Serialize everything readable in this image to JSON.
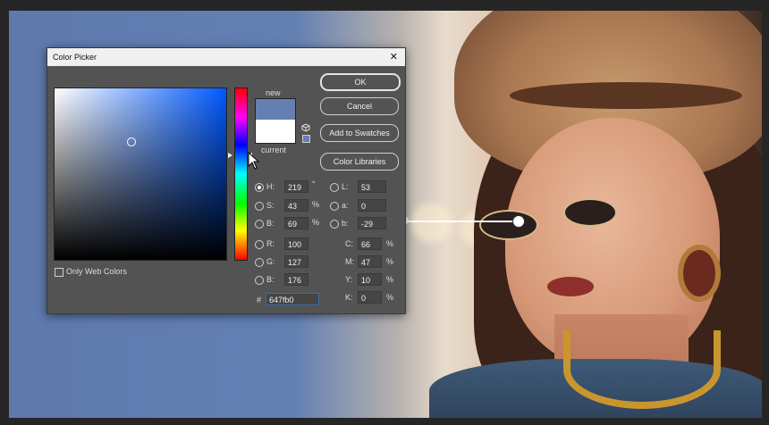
{
  "dialog": {
    "title": "Color Picker",
    "close_glyph": "✕",
    "labels": {
      "new": "new",
      "current": "current"
    },
    "colors": {
      "new": "#647fb0",
      "current": "#ffffff"
    },
    "buttons": {
      "ok": "OK",
      "cancel": "Cancel",
      "add_to_swatches": "Add to Swatches",
      "color_libraries": "Color Libraries"
    },
    "hsb": [
      {
        "label": "H:",
        "value": "219",
        "unit": "°",
        "selected": true
      },
      {
        "label": "S:",
        "value": "43",
        "unit": "%",
        "selected": false
      },
      {
        "label": "B:",
        "value": "69",
        "unit": "%",
        "selected": false
      }
    ],
    "rgb": [
      {
        "label": "R:",
        "value": "100"
      },
      {
        "label": "G:",
        "value": "127"
      },
      {
        "label": "B:",
        "value": "176"
      }
    ],
    "lab": [
      {
        "label": "L:",
        "value": "53"
      },
      {
        "label": "a:",
        "value": "0"
      },
      {
        "label": "b:",
        "value": "-29"
      }
    ],
    "cmyk": [
      {
        "label": "C:",
        "value": "66",
        "unit": "%"
      },
      {
        "label": "M:",
        "value": "47",
        "unit": "%"
      },
      {
        "label": "Y:",
        "value": "10",
        "unit": "%"
      },
      {
        "label": "K:",
        "value": "0",
        "unit": "%"
      }
    ],
    "hex": {
      "label": "#",
      "value": "647fb0"
    },
    "only_web_colors": {
      "label": "Only Web Colors",
      "checked": false
    },
    "icons": [
      "close-icon",
      "gamut-cube-icon",
      "cursor-icon"
    ]
  }
}
